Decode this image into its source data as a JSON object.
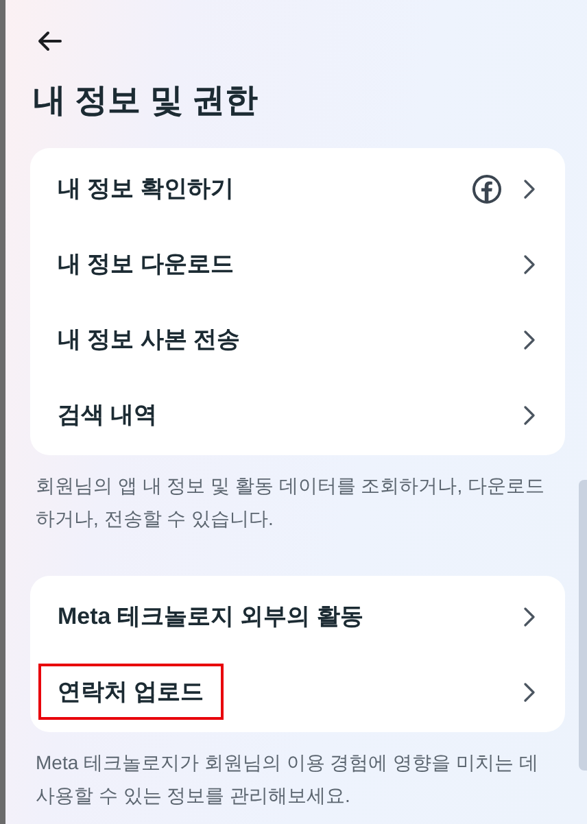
{
  "title": "내 정보 및 권한",
  "sections": [
    {
      "items": [
        {
          "label": "내 정보 확인하기",
          "has_icon": true,
          "highlighted": false
        },
        {
          "label": "내 정보 다운로드",
          "has_icon": false,
          "highlighted": false
        },
        {
          "label": "내 정보 사본 전송",
          "has_icon": false,
          "highlighted": false
        },
        {
          "label": "검색 내역",
          "has_icon": false,
          "highlighted": false
        }
      ],
      "description": "회원님의 앱 내 정보 및 활동 데이터를 조회하거나, 다운로드하거나, 전송할 수 있습니다."
    },
    {
      "items": [
        {
          "label": "Meta 테크놀로지 외부의 활동",
          "has_icon": false,
          "highlighted": false
        },
        {
          "label": "연락처 업로드",
          "has_icon": false,
          "highlighted": true
        }
      ],
      "description": "Meta 테크놀로지가 회원님의 이용 경험에 영향을 미치는 데 사용할 수 있는 정보를 관리해보세요."
    }
  ]
}
